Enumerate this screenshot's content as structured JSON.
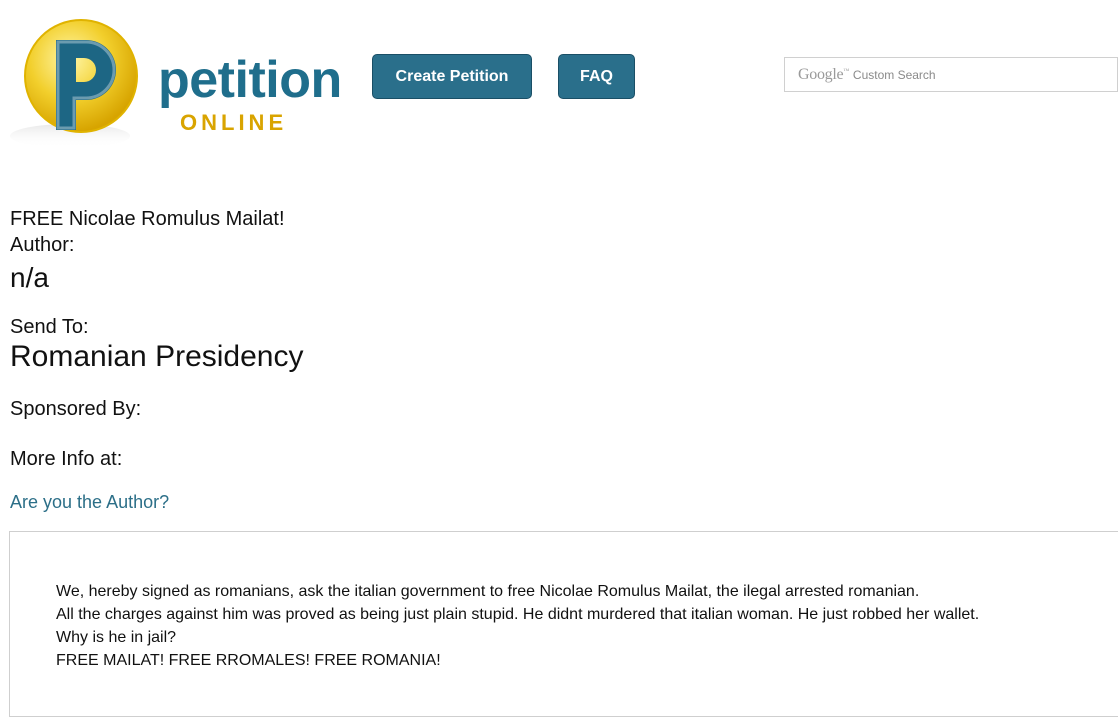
{
  "header": {
    "logo": {
      "word": "petition",
      "sub": "ONLINE"
    },
    "buttons": {
      "create_label": "Create Petition",
      "faq_label": "FAQ"
    },
    "search": {
      "brand": "Google",
      "placeholder": "Custom Search"
    }
  },
  "petition": {
    "title": "FREE Nicolae Romulus Mailat!",
    "author_label": "Author:",
    "author_value": "n/a",
    "send_to_label": "Send To:",
    "send_to_value": "Romanian Presidency",
    "sponsored_label": "Sponsored By:",
    "more_info_label": "More Info at:",
    "author_link": "Are you the Author?",
    "body_lines": [
      "We, hereby signed as romanians, ask the italian government to free Nicolae Romulus Mailat, the ilegal arrested romanian.",
      "All the charges against him was proved as being just plain stupid. He didnt murdered that italian woman. He just robbed her wallet.",
      "Why is he in jail?",
      "FREE MAILAT! FREE RROMALES! FREE ROMANIA!"
    ]
  },
  "colors": {
    "brand_teal": "#1f6e8c",
    "brand_gold": "#d9a400",
    "button_bg": "#2a6f8b",
    "link": "#2c6f88"
  }
}
